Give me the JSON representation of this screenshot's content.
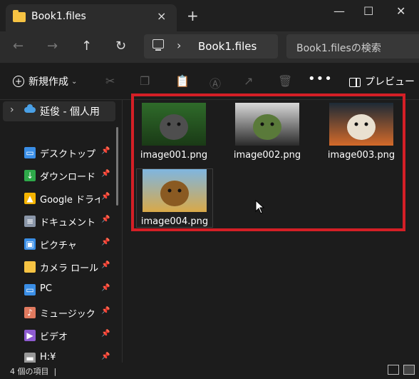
{
  "window": {
    "tab_title": "Book1.files",
    "close_tab": "×",
    "new_tab": "+",
    "min": "—",
    "max": "☐",
    "close": "✕"
  },
  "nav": {
    "back": "←",
    "forward": "→",
    "up": "↑",
    "refresh": "↻",
    "chevron": "›",
    "address": "Book1.files",
    "search_placeholder": "Book1.filesの検索"
  },
  "toolbar": {
    "new_label": "新規作成",
    "new_chevron": "⌄",
    "more": "•••",
    "preview_label": "プレビュー",
    "icons": [
      "cut-icon",
      "copy-icon",
      "paste-icon",
      "rename-icon",
      "share-icon",
      "delete-icon"
    ]
  },
  "sidebar": {
    "top_item": "延俊 - 個人用",
    "chevron": "›",
    "items": [
      {
        "label": "デスクトップ",
        "icon": "desktop-icon",
        "color": "#3a8ee6",
        "pinned": true
      },
      {
        "label": "ダウンロード",
        "icon": "download-icon",
        "color": "#2eaa4a",
        "pinned": true
      },
      {
        "label": "Google ドライブ",
        "icon": "google-drive-icon",
        "color": "#f5b400",
        "pinned": true
      },
      {
        "label": "ドキュメント",
        "icon": "document-icon",
        "color": "#8a96a8",
        "pinned": true
      },
      {
        "label": "ピクチャ",
        "icon": "picture-icon",
        "color": "#3a8ee6",
        "pinned": true
      },
      {
        "label": "カメラ ロール",
        "icon": "folder-icon",
        "color": "#f6c343",
        "pinned": true
      },
      {
        "label": "PC",
        "icon": "pc-icon",
        "color": "#3a8ee6",
        "pinned": true
      },
      {
        "label": "ミュージック",
        "icon": "music-icon",
        "color": "#e07a5f",
        "pinned": true
      },
      {
        "label": "ビデオ",
        "icon": "video-icon",
        "color": "#8e5bd1",
        "pinned": true
      },
      {
        "label": "H:¥",
        "icon": "drive-icon",
        "color": "#999999",
        "pinned": true
      }
    ],
    "pin_glyph": "📌"
  },
  "files": [
    {
      "name": "image001.png",
      "thumb": "chimpanzee",
      "colors": [
        "#2f6b2a",
        "#1a3a16",
        "#4e4e4e"
      ]
    },
    {
      "name": "image002.png",
      "thumb": "panda",
      "colors": [
        "#d8d8d8",
        "#2b2b2b",
        "#5a7a3a"
      ]
    },
    {
      "name": "image003.png",
      "thumb": "fox",
      "colors": [
        "#1d2a36",
        "#d46a2a",
        "#e9e0d0"
      ]
    },
    {
      "name": "image004.png",
      "thumb": "lion",
      "colors": [
        "#7fb6e0",
        "#d9a948",
        "#8a5a22"
      ]
    }
  ],
  "status": {
    "count": "4 個の項目",
    "separator": "|"
  },
  "colors": {
    "accent": "#d41f26"
  }
}
